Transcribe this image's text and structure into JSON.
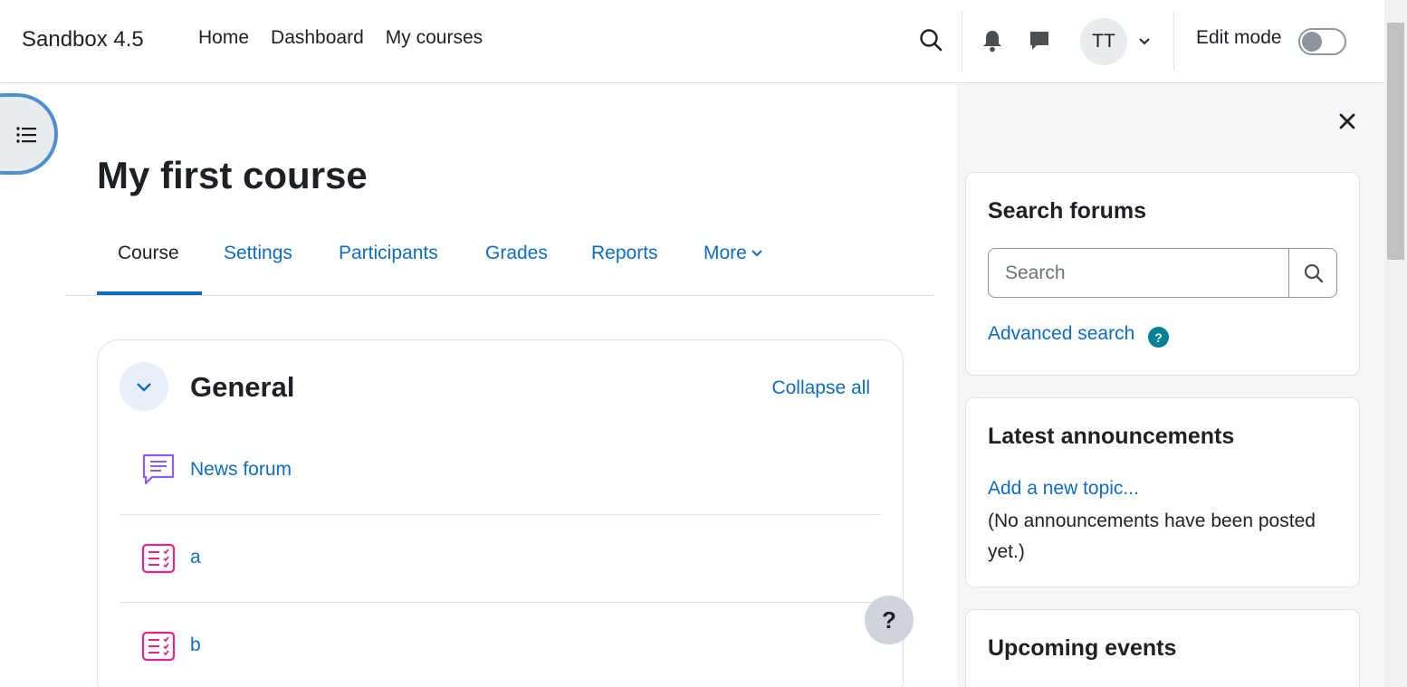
{
  "navbar": {
    "brand": "Sandbox 4.5",
    "nav_items": [
      {
        "label": "Home"
      },
      {
        "label": "Dashboard"
      },
      {
        "label": "My courses"
      }
    ],
    "user_initials": "TT",
    "edit_mode_label": "Edit mode",
    "edit_mode_on": false
  },
  "course": {
    "title": "My first course",
    "tabs": [
      {
        "label": "Course",
        "active": true
      },
      {
        "label": "Settings"
      },
      {
        "label": "Participants"
      },
      {
        "label": "Grades"
      },
      {
        "label": "Reports"
      },
      {
        "label": "More"
      }
    ]
  },
  "section": {
    "title": "General",
    "collapse_all": "Collapse all",
    "activities": [
      {
        "name": "News forum",
        "icon": "forum-icon"
      },
      {
        "name": "a",
        "icon": "assignment-icon"
      },
      {
        "name": "b",
        "icon": "assignment-icon"
      }
    ]
  },
  "help_button": "?",
  "blocks": {
    "search_forums": {
      "title": "Search forums",
      "placeholder": "Search",
      "advanced_search": "Advanced search"
    },
    "latest_announcements": {
      "title": "Latest announcements",
      "add_topic": "Add a new topic...",
      "empty_text": "(No announcements have been posted yet.)"
    },
    "upcoming_events": {
      "title": "Upcoming events"
    }
  },
  "colors": {
    "link": "#0f6cbf",
    "text": "#1d2125",
    "forum_icon": "#8b5cf6",
    "assignment_icon": "#e6248a",
    "help_icon_bg": "#008196"
  }
}
